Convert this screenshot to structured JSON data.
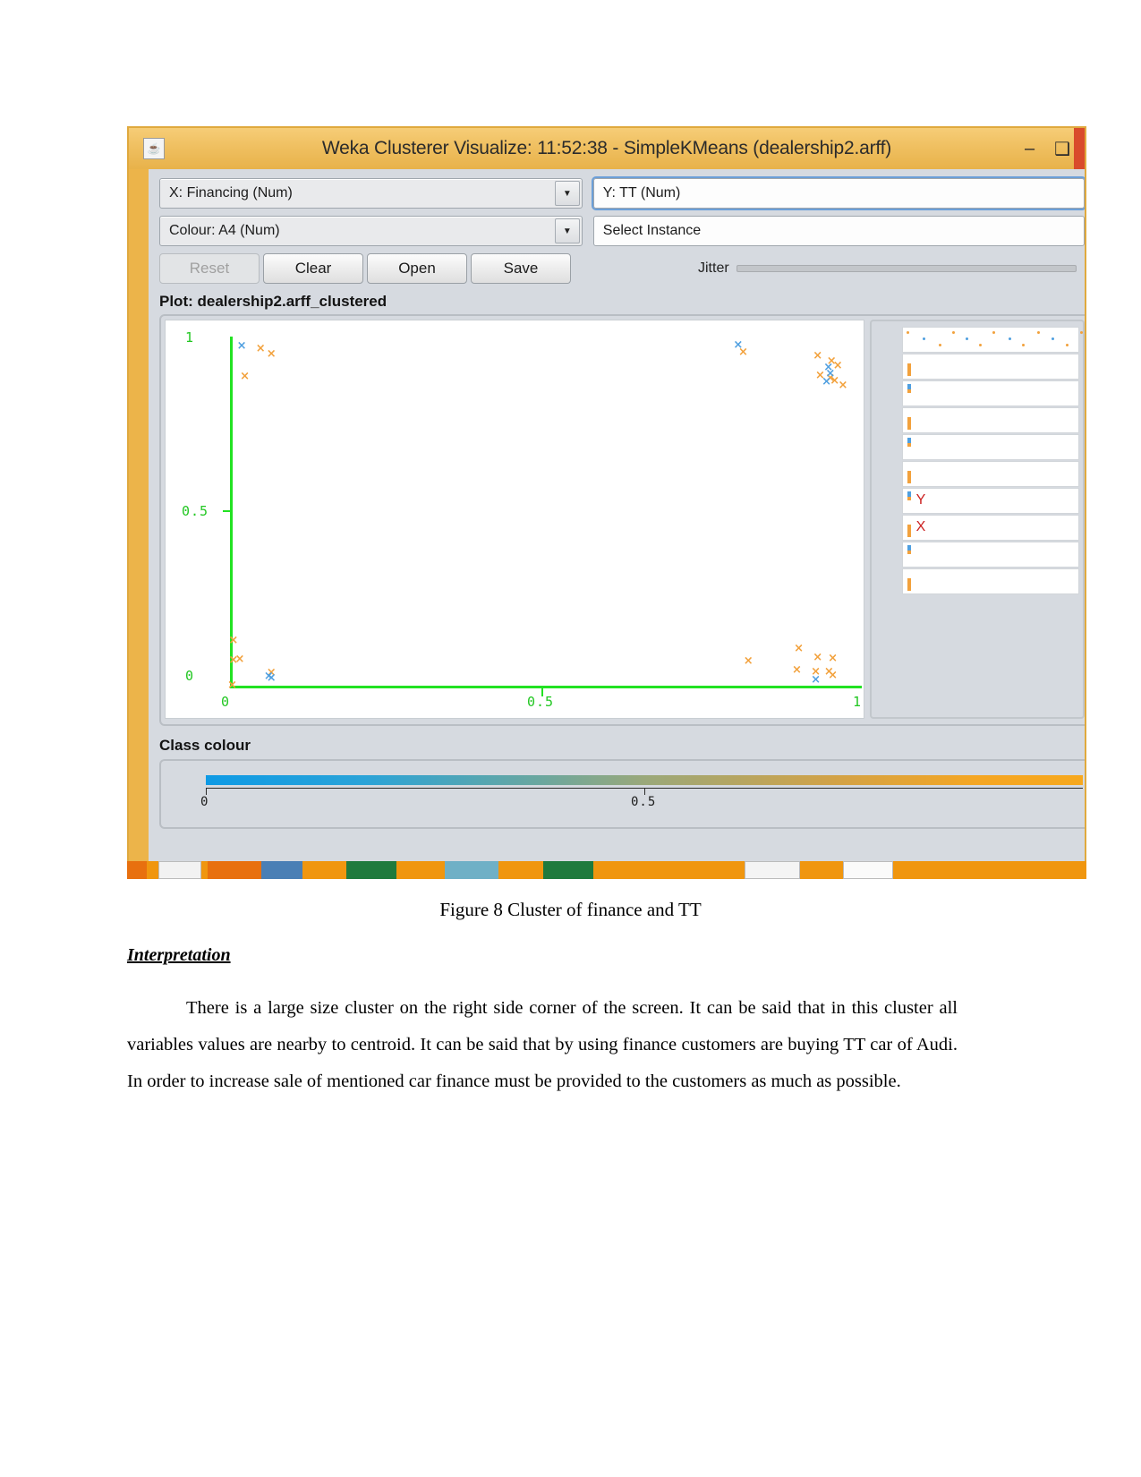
{
  "window": {
    "title": "Weka Clusterer Visualize: 11:52:38 - SimpleKMeans (dealership2.arff)",
    "app_icon": "weka-java-icon",
    "minimize_label": "–",
    "maximize_label": "❑"
  },
  "controls": {
    "x_attribute": "X: Financing (Num)",
    "y_attribute": "Y: TT (Num)",
    "colour_attribute": "Colour: A4 (Num)",
    "instance_selector": "Select Instance",
    "buttons": [
      {
        "label": "Reset",
        "enabled": false
      },
      {
        "label": "Clear",
        "enabled": true
      },
      {
        "label": "Open",
        "enabled": true
      },
      {
        "label": "Save",
        "enabled": true
      }
    ],
    "jitter_label": "Jitter",
    "jitter_value": 0
  },
  "plot": {
    "title": "Plot: dealership2.arff_clustered"
  },
  "class_colour": {
    "label": "Class colour",
    "ticks": [
      "0",
      "0.5"
    ],
    "gradient_start": "#0e9ae5",
    "gradient_end": "#f7a81e"
  },
  "attribute_panel": {
    "y_marker": "Y",
    "x_marker": "X",
    "row_count": 10
  },
  "document": {
    "figure_caption": "Figure 8 Cluster of finance and TT",
    "section_heading": "Interpretation",
    "paragraph": "There is a large size cluster on the right side corner of the screen. It can be said that in this cluster all variables values are nearby to centroid. It can be said that by using finance customers are buying TT car of Audi. In order to increase sale of mentioned car finance must be provided to the customers as much as possible."
  },
  "chart_data": {
    "type": "scatter",
    "title": "Plot: dealership2.arff_clustered",
    "xlabel": "Financing (Num)",
    "ylabel": "TT (Num)",
    "xlim": [
      0,
      1
    ],
    "ylim": [
      0,
      1
    ],
    "xticks": [
      "0",
      "0.5",
      "1"
    ],
    "yticks": [
      "0",
      "0.5",
      "1"
    ],
    "grid": false,
    "marker": "x",
    "legend": "none",
    "colours": {
      "cluster0": "#f2a13c",
      "cluster1": "#4f9fe0"
    },
    "series": [
      {
        "name": "cluster0",
        "colour": "#f2a13c",
        "points": [
          [
            0.045,
            0.965
          ],
          [
            0.062,
            0.95
          ],
          [
            0.02,
            0.885
          ],
          [
            0.002,
            0.13
          ],
          [
            0.002,
            0.075
          ],
          [
            0.012,
            0.078
          ],
          [
            0.062,
            0.038
          ],
          [
            0.0,
            0.003
          ],
          [
            0.81,
            0.955
          ],
          [
            0.928,
            0.945
          ],
          [
            0.95,
            0.928
          ],
          [
            0.96,
            0.915
          ],
          [
            0.932,
            0.888
          ],
          [
            0.948,
            0.88
          ],
          [
            0.955,
            0.872
          ],
          [
            0.968,
            0.86
          ],
          [
            0.818,
            0.072
          ],
          [
            0.898,
            0.108
          ],
          [
            0.928,
            0.082
          ],
          [
            0.952,
            0.08
          ],
          [
            0.895,
            0.045
          ],
          [
            0.925,
            0.042
          ],
          [
            0.946,
            0.04
          ],
          [
            0.952,
            0.03
          ]
        ]
      },
      {
        "name": "cluster1",
        "colour": "#4f9fe0",
        "points": [
          [
            0.015,
            0.972
          ],
          [
            0.058,
            0.028
          ],
          [
            0.062,
            0.022
          ],
          [
            0.802,
            0.975
          ],
          [
            0.945,
            0.91
          ],
          [
            0.948,
            0.893
          ],
          [
            0.942,
            0.87
          ],
          [
            0.925,
            0.018
          ]
        ]
      }
    ]
  }
}
